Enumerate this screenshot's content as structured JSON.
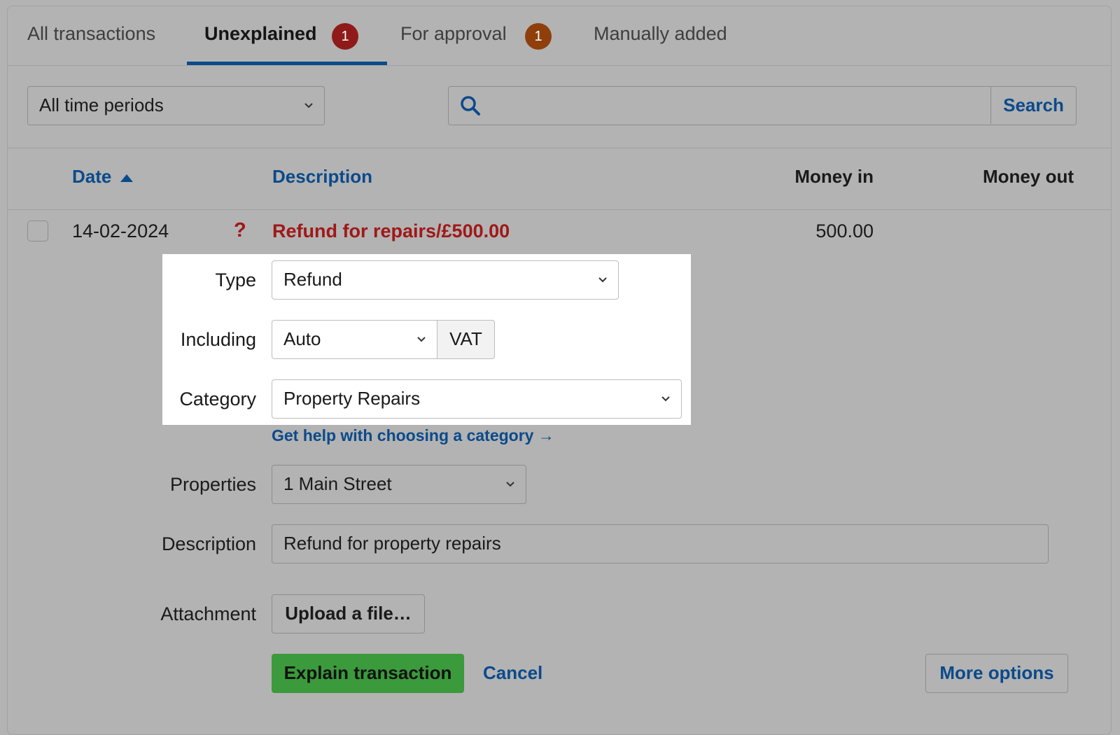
{
  "tabs": [
    {
      "label": "All transactions",
      "badge": null
    },
    {
      "label": "Unexplained",
      "badge": "1",
      "badge_color": "#8f1a1a"
    },
    {
      "label": "For approval",
      "badge": "1",
      "badge_color": "#8f3f0c"
    },
    {
      "label": "Manually added",
      "badge": null
    }
  ],
  "active_tab": "Unexplained",
  "filters": {
    "period_selected": "All time periods",
    "search_value": "",
    "search_button": "Search"
  },
  "table": {
    "columns": {
      "date": "Date",
      "description": "Description",
      "money_in": "Money in",
      "money_out": "Money out"
    },
    "sort": {
      "column": "date",
      "direction": "ascending"
    },
    "row": {
      "date": "14-02-2024",
      "status_glyph": "?",
      "description": "Refund for repairs/£500.00",
      "money_in": "500.00",
      "money_out": ""
    }
  },
  "form": {
    "type_label": "Type",
    "type_value": "Refund",
    "including_label": "Including",
    "including_value": "Auto",
    "vat_label": "VAT",
    "category_label": "Category",
    "category_value": "Property Repairs",
    "help_link": "Get help with choosing a category →",
    "properties_label": "Properties",
    "properties_value": "1 Main Street",
    "description_label": "Description",
    "description_value": "Refund for property repairs",
    "attachment_label": "Attachment",
    "upload_button": "Upload a file…",
    "explain_button": "Explain transaction",
    "cancel_link": "Cancel",
    "more_options_button": "More options"
  },
  "colors": {
    "link": "#0b4a8b",
    "error_red": "#a01818",
    "primary_green": "#3b9a3b",
    "overlay_grey": "#b3b3b3"
  }
}
